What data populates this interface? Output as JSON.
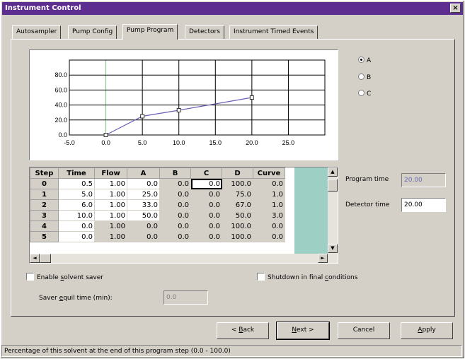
{
  "window": {
    "title": "Instrument Control",
    "close_glyph": "×"
  },
  "tabs": [
    {
      "label": "Autosampler"
    },
    {
      "label": "Pump Config"
    },
    {
      "label": "Pump Program",
      "active": true
    },
    {
      "label": "Detectors"
    },
    {
      "label": "Instrument Timed Events"
    }
  ],
  "chart_data": {
    "type": "line",
    "x": [
      0.0,
      5.0,
      10.0,
      20.0
    ],
    "series": [
      {
        "values": [
          0.0,
          25.0,
          33.0,
          50.0
        ],
        "color": "#6b5fb5"
      }
    ],
    "xlim": [
      -5.0,
      30.0
    ],
    "ylim": [
      0.0,
      100.0
    ],
    "xticks": [
      "-5.0",
      "0.0",
      "5.0",
      "10.0",
      "15.0",
      "20.0",
      "25.0"
    ],
    "yticks": [
      "0.0",
      "20.0",
      "40.0",
      "60.0",
      "80.0"
    ],
    "grid": true
  },
  "radios": [
    {
      "label": "A",
      "checked": true
    },
    {
      "label": "B",
      "checked": false
    },
    {
      "label": "C",
      "checked": false
    }
  ],
  "table": {
    "headers": [
      "Step",
      "Time",
      "Flow",
      "A",
      "B",
      "C",
      "D",
      "Curve"
    ],
    "rows": [
      [
        "0",
        "0.5",
        "1.00",
        "0.0",
        "0.0",
        "0.0",
        "100.0",
        "0.0"
      ],
      [
        "1",
        "5.0",
        "1.00",
        "25.0",
        "0.0",
        "0.0",
        "75.0",
        "1.0"
      ],
      [
        "2",
        "6.0",
        "1.00",
        "33.0",
        "0.0",
        "0.0",
        "67.0",
        "1.0"
      ],
      [
        "3",
        "10.0",
        "1.00",
        "50.0",
        "0.0",
        "0.0",
        "50.0",
        "3.0"
      ],
      [
        "4",
        "0.0",
        "1.00",
        "0.0",
        "0.0",
        "0.0",
        "100.0",
        "0.0"
      ],
      [
        "5",
        "0.0",
        "1.00",
        "0.0",
        "0.0",
        "0.0",
        "100.0",
        "0.0"
      ]
    ]
  },
  "program_time": {
    "label": "Program time",
    "value": "20.00"
  },
  "detector_time": {
    "label": "Detector time",
    "value": "20.00"
  },
  "solvent_saver": {
    "label_pre": "Enable ",
    "label_key": "s",
    "label_post": "olvent saver"
  },
  "saver_equil": {
    "label_pre": "Saver ",
    "label_key": "e",
    "label_post": "quil time (min):",
    "value": "0.0"
  },
  "shutdown": {
    "label_pre": "Shutdown in final ",
    "label_key": "c",
    "label_post": "onditions"
  },
  "buttons": {
    "back": {
      "pre": "< ",
      "key": "B",
      "post": "ack"
    },
    "next": {
      "pre": "",
      "key": "N",
      "post": "ext >"
    },
    "cancel": {
      "label": "Cancel"
    },
    "apply": {
      "key": "A",
      "post": "pply"
    }
  },
  "status_text": "Percentage of this solvent at the end of this program step (0.0 - 100.0)"
}
